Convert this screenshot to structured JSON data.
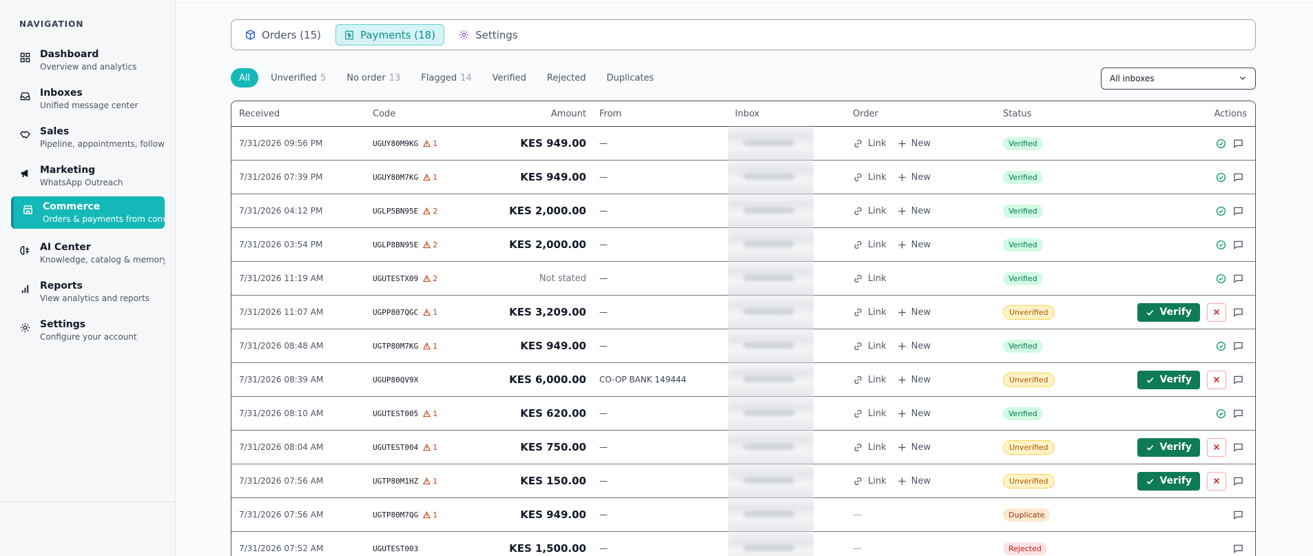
{
  "nav": {
    "heading": "NAVIGATION",
    "items": [
      {
        "title": "Dashboard",
        "subtitle": "Overview and analytics",
        "icon": "dashboard-icon"
      },
      {
        "title": "Inboxes",
        "subtitle": "Unified message center",
        "icon": "inbox-icon"
      },
      {
        "title": "Sales",
        "subtitle": "Pipeline, appointments, follow-ups",
        "icon": "handshake-icon"
      },
      {
        "title": "Marketing",
        "subtitle": "WhatsApp Outreach",
        "icon": "megaphone-icon"
      },
      {
        "title": "Commerce",
        "subtitle": "Orders & payments from conversations",
        "icon": "store-icon"
      },
      {
        "title": "AI Center",
        "subtitle": "Knowledge, catalog & memory",
        "icon": "brain-icon"
      },
      {
        "title": "Reports",
        "subtitle": "View analytics and reports",
        "icon": "bar-chart-icon"
      },
      {
        "title": "Settings",
        "subtitle": "Configure your account",
        "icon": "gear-icon"
      }
    ]
  },
  "tabs": [
    {
      "label": "Orders (15)",
      "icon": "box-icon"
    },
    {
      "label": "Payments (18)",
      "icon": "receipt-icon"
    },
    {
      "label": "Settings",
      "icon": "gear-icon"
    }
  ],
  "filters": [
    {
      "label": "All",
      "count": ""
    },
    {
      "label": "Unverified",
      "count": "5"
    },
    {
      "label": "No order",
      "count": "13"
    },
    {
      "label": "Flagged",
      "count": "14"
    },
    {
      "label": "Verified",
      "count": ""
    },
    {
      "label": "Rejected",
      "count": ""
    },
    {
      "label": "Duplicates",
      "count": ""
    }
  ],
  "inbox_select": {
    "value": "All inboxes"
  },
  "table": {
    "headers": {
      "received": "Received",
      "code": "Code",
      "amount": "Amount",
      "from": "From",
      "inbox": "Inbox",
      "order": "Order",
      "status": "Status",
      "actions": "Actions"
    },
    "link_label": "Link",
    "new_label": "New",
    "verify_label": "Verify",
    "dash": "—",
    "rows": [
      {
        "received": "7/31/2026 09:56 PM",
        "code": "UGUY80M9KG",
        "flags": "1",
        "amount": "KES 949.00",
        "from": "—",
        "order": "link-new",
        "status": "Verified"
      },
      {
        "received": "7/31/2026 07:39 PM",
        "code": "UGUY80M7KG",
        "flags": "1",
        "amount": "KES 949.00",
        "from": "—",
        "order": "link-new",
        "status": "Verified"
      },
      {
        "received": "7/31/2026 04:12 PM",
        "code": "UGLP5BN95E",
        "flags": "2",
        "amount": "KES 2,000.00",
        "from": "—",
        "order": "link-new",
        "status": "Verified"
      },
      {
        "received": "7/31/2026 03:54 PM",
        "code": "UGLP8BN95E",
        "flags": "2",
        "amount": "KES 2,000.00",
        "from": "—",
        "order": "link-new",
        "status": "Verified"
      },
      {
        "received": "7/31/2026 11:19 AM",
        "code": "UGUTESTX09",
        "flags": "2",
        "amount": "Not stated",
        "from": "—",
        "order": "link",
        "status": "Verified"
      },
      {
        "received": "7/31/2026 11:07 AM",
        "code": "UGPP807QGC",
        "flags": "1",
        "amount": "KES 3,209.00",
        "from": "—",
        "order": "link-new",
        "status": "Unverified"
      },
      {
        "received": "7/31/2026 08:48 AM",
        "code": "UGTP80M7KG",
        "flags": "1",
        "amount": "KES 949.00",
        "from": "—",
        "order": "link-new",
        "status": "Verified"
      },
      {
        "received": "7/31/2026 08:39 AM",
        "code": "UGUP80QV9X",
        "flags": "",
        "amount": "KES 6,000.00",
        "from": "CO-OP BANK 149444",
        "order": "link-new",
        "status": "Unverified"
      },
      {
        "received": "7/31/2026 08:10 AM",
        "code": "UGUTEST005",
        "flags": "1",
        "amount": "KES 620.00",
        "from": "—",
        "order": "link-new",
        "status": "Verified"
      },
      {
        "received": "7/31/2026 08:04 AM",
        "code": "UGUTEST004",
        "flags": "1",
        "amount": "KES 750.00",
        "from": "—",
        "order": "link-new",
        "status": "Unverified"
      },
      {
        "received": "7/31/2026 07:56 AM",
        "code": "UGTP80M1HZ",
        "flags": "1",
        "amount": "KES 150.00",
        "from": "—",
        "order": "link-new",
        "status": "Unverified"
      },
      {
        "received": "7/31/2026 07:56 AM",
        "code": "UGTP80M7QG",
        "flags": "1",
        "amount": "KES 949.00",
        "from": "—",
        "order": "none",
        "status": "Duplicate"
      },
      {
        "received": "7/31/2026 07:52 AM",
        "code": "UGUTEST003",
        "flags": "",
        "amount": "KES 1,500.00",
        "from": "—",
        "order": "none",
        "status": "Rejected"
      }
    ]
  },
  "colors": {
    "accent": "#14b8b8",
    "verify": "#0f7a58",
    "warn": "#c2410c"
  }
}
